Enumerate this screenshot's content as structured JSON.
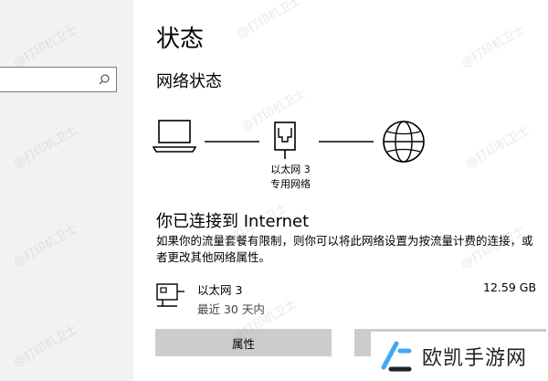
{
  "page": {
    "title": "状态",
    "section_title": "网络状态"
  },
  "diagram": {
    "adapter_name": "以太网 3",
    "adapter_type": "专用网络"
  },
  "connection": {
    "title": "你已连接到 Internet",
    "note": "如果你的流量套餐有限制，则你可以将此网络设置为按流量计费的连接，或者更改其他网络属性。"
  },
  "usage": {
    "name": "以太网 3",
    "period": "最近 30 天内",
    "amount": "12.59 GB"
  },
  "buttons": {
    "properties": "属性",
    "second": ""
  },
  "watermark": {
    "text": "@打印机卫士"
  },
  "logo": {
    "text": "欧凯手游网",
    "accent": "#3fa9f5"
  }
}
